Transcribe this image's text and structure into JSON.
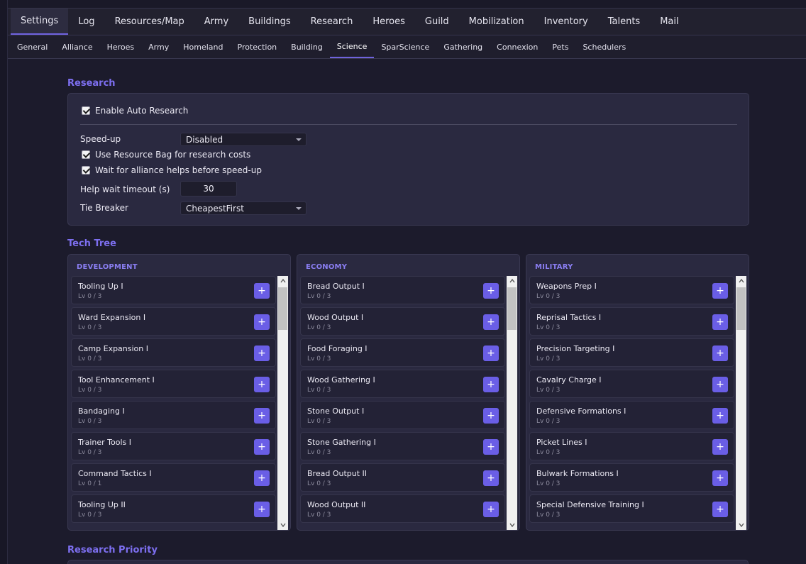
{
  "main_tabs": [
    {
      "label": "Settings",
      "active": true
    },
    {
      "label": "Log"
    },
    {
      "label": "Resources/Map"
    },
    {
      "label": "Army"
    },
    {
      "label": "Buildings"
    },
    {
      "label": "Research"
    },
    {
      "label": "Heroes"
    },
    {
      "label": "Guild"
    },
    {
      "label": "Mobilization"
    },
    {
      "label": "Inventory"
    },
    {
      "label": "Talents"
    },
    {
      "label": "Mail"
    }
  ],
  "sub_tabs": [
    {
      "label": "General"
    },
    {
      "label": "Alliance"
    },
    {
      "label": "Heroes"
    },
    {
      "label": "Army"
    },
    {
      "label": "Homeland"
    },
    {
      "label": "Protection"
    },
    {
      "label": "Building"
    },
    {
      "label": "Science",
      "active": true
    },
    {
      "label": "SparScience"
    },
    {
      "label": "Gathering"
    },
    {
      "label": "Connexion"
    },
    {
      "label": "Pets"
    },
    {
      "label": "Schedulers"
    }
  ],
  "research": {
    "title": "Research",
    "enable_auto_research": {
      "label": "Enable Auto Research",
      "checked": true
    },
    "speed_up": {
      "label": "Speed-up",
      "value": "Disabled"
    },
    "use_resource_bag": {
      "label": "Use Resource Bag for research costs",
      "checked": true
    },
    "wait_alliance_helps": {
      "label": "Wait for alliance helps before speed-up",
      "checked": true
    },
    "help_wait_timeout": {
      "label": "Help wait timeout (s)",
      "value": "30"
    },
    "tie_breaker": {
      "label": "Tie Breaker",
      "value": "CheapestFirst"
    }
  },
  "tech_tree": {
    "title": "Tech Tree",
    "add_label": "+",
    "columns": [
      {
        "header": "DEVELOPMENT",
        "items": [
          {
            "name": "Tooling Up I",
            "level": "Lv 0 / 3"
          },
          {
            "name": "Ward Expansion I",
            "level": "Lv 0 / 3"
          },
          {
            "name": "Camp Expansion I",
            "level": "Lv 0 / 3"
          },
          {
            "name": "Tool Enhancement I",
            "level": "Lv 0 / 3"
          },
          {
            "name": "Bandaging I",
            "level": "Lv 0 / 3"
          },
          {
            "name": "Trainer Tools I",
            "level": "Lv 0 / 3"
          },
          {
            "name": "Command Tactics I",
            "level": "Lv 0 / 1"
          },
          {
            "name": "Tooling Up II",
            "level": "Lv 0 / 3"
          }
        ]
      },
      {
        "header": "ECONOMY",
        "items": [
          {
            "name": "Bread Output I",
            "level": "Lv 0 / 3"
          },
          {
            "name": "Wood Output I",
            "level": "Lv 0 / 3"
          },
          {
            "name": "Food Foraging I",
            "level": "Lv 0 / 3"
          },
          {
            "name": "Wood Gathering I",
            "level": "Lv 0 / 3"
          },
          {
            "name": "Stone Output I",
            "level": "Lv 0 / 3"
          },
          {
            "name": "Stone Gathering I",
            "level": "Lv 0 / 3"
          },
          {
            "name": "Bread Output II",
            "level": "Lv 0 / 3"
          },
          {
            "name": "Wood Output II",
            "level": "Lv 0 / 3"
          }
        ]
      },
      {
        "header": "MILITARY",
        "items": [
          {
            "name": "Weapons Prep I",
            "level": "Lv 0 / 3"
          },
          {
            "name": "Reprisal Tactics I",
            "level": "Lv 0 / 3"
          },
          {
            "name": "Precision Targeting I",
            "level": "Lv 0 / 3"
          },
          {
            "name": "Cavalry Charge I",
            "level": "Lv 0 / 3"
          },
          {
            "name": "Defensive Formations I",
            "level": "Lv 0 / 3"
          },
          {
            "name": "Picket Lines I",
            "level": "Lv 0 / 3"
          },
          {
            "name": "Bulwark Formations I",
            "level": "Lv 0 / 3"
          },
          {
            "name": "Special Defensive Training I",
            "level": "Lv 0 / 3"
          }
        ]
      }
    ]
  },
  "research_priority": {
    "title": "Research Priority"
  }
}
